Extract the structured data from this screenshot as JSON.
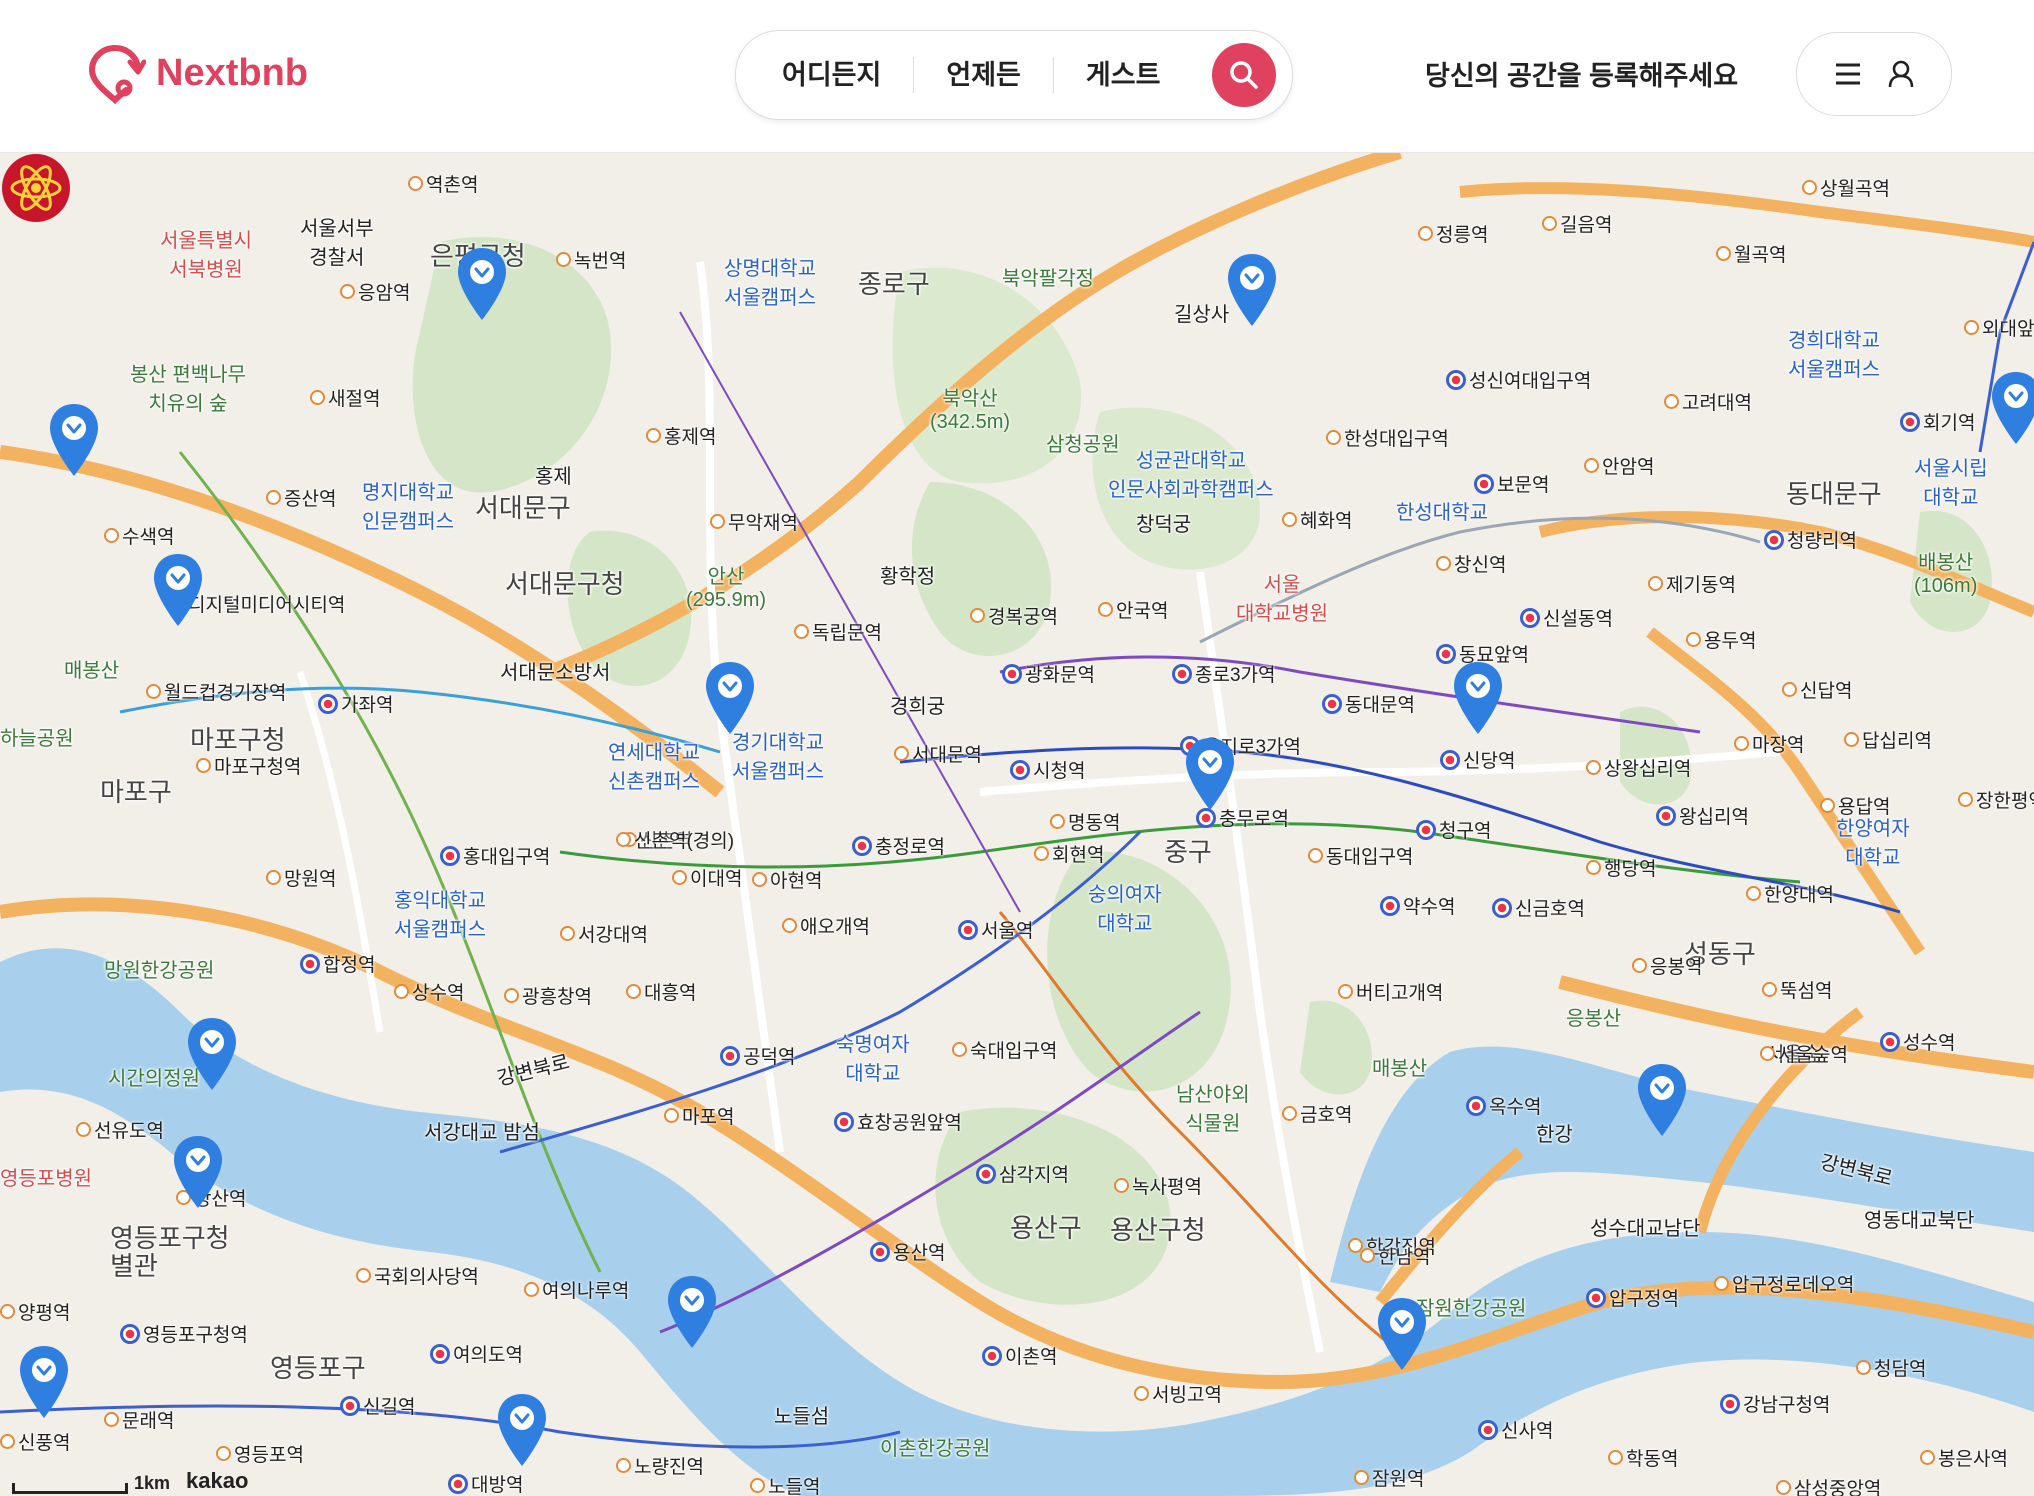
{
  "header": {
    "brand": "Nextbnb",
    "search": {
      "where": "어디든지",
      "when": "언제든",
      "guests": "게스트"
    },
    "host_link": "당신의 공간을 등록해주세요"
  },
  "colors": {
    "brand": "#e0415f",
    "water": "#a8d0ec",
    "park": "#cfe3c3",
    "road_major": "#f3b260"
  },
  "map": {
    "attribution": "kakao",
    "scale_label": "1km",
    "districts": [
      "종로구",
      "서대문구",
      "마포구",
      "동대문구",
      "중구",
      "용산구",
      "영등포구",
      "성동구"
    ],
    "labels": {
      "jongno_gu": "종로구",
      "seodaemun_gu": "서대문구",
      "seodaemun_office": "서대문구청",
      "mapo_gu": "마포구",
      "mapo_office": "마포구청",
      "dongdaemun_gu": "동대문구",
      "jung_gu": "중구",
      "yongsan_gu": "용산구",
      "yongsan_office": "용산구청",
      "yeongdeungpo_gu": "영등포구",
      "yeongdeungpo_office": "영등포구청\n별관",
      "seongdong_gu": "성동구",
      "eunpyeong_office": "은평구청",
      "gilsangsa": "길상사",
      "bugaksan": "북악산\n(342.5m)",
      "bugak_palgakjeong": "북악팔각정",
      "samcheong_park": "삼청공원",
      "ansan": "안산\n(295.9m)",
      "inwang": "홍제",
      "sangmyung": "상명대학교\n서울캠퍼스",
      "skku": "성균관대학교\n인문사회과학캠퍼스",
      "hansung": "한성대학교",
      "myongji": "명지대학교\n인문캠퍼스",
      "yonsei": "연세대학교\n신촌캠퍼스",
      "kyonggi": "경기대학교\n서울캠퍼스",
      "hongik": "홍익대학교\n서울캠퍼스",
      "sookmyung": "숙명여자\n대학교",
      "sungshin": "숭의여자\n대학교",
      "kyunghee": "경희대학교\n서울캠퍼스",
      "uos": "서울시립\n대학교",
      "hanyang": "한양여자\n대학교",
      "seoul_univ_hospital": "서울\n대학교병원",
      "seobuk_hospital": "서울특별시\n서북병원",
      "seoul_seobu_police": "서울서부\n경찰서",
      "seodaemun_fire": "서대문소방서",
      "changdeokgung": "창덕궁",
      "gyeonghuigung": "경희궁",
      "hwanghakjeong": "황학정",
      "bongsan": "봉산 편백나무\n치유의 숲",
      "maebongsan": "매봉산",
      "maebongsan2": "매봉산",
      "baebongsan": "배봉산\n(106m)",
      "eungbongsan": "응봉산",
      "namsan": "남산야외\n식물원",
      "mangwon_park": "망원한강공원",
      "ichon_park": "이촌한강공원",
      "jamwon_park": "잠원한강공원",
      "seoul_forest": "서울숲",
      "nodeulseom": "노들섬",
      "bamseom": "서강대교 밤섬",
      "gangbyeonbukro": "강변북로",
      "hangang": "한강",
      "sigan_garden": "시간의정원",
      "wcup_park": "하늘공원",
      "yeongdong_bridge": "영동대교북단",
      "seongsu_bridge": "성수대교남단",
      "yeongdeungpo_hospital": "영등포병원"
    },
    "stations": [
      "역촌역",
      "녹번역",
      "응암역",
      "새절역",
      "증산역",
      "수색역",
      "디지털미디어시티역",
      "월드컵경기장역",
      "가좌역",
      "마포구청역",
      "망원역",
      "합정역",
      "상수역",
      "광흥창역",
      "대흥역",
      "공덕역",
      "마포역",
      "홍대입구역",
      "신촌역",
      "이대역",
      "아현역",
      "애오개역",
      "충정로역",
      "서대문역",
      "광화문역",
      "시청역",
      "종로3가역",
      "을지로3가역",
      "충무로역",
      "명동역",
      "회현역",
      "서울역",
      "숙대입구역",
      "효창공원앞역",
      "삼각지역",
      "녹사평역",
      "용산역",
      "이촌역",
      "서빙고역",
      "한강진역",
      "버티고개역",
      "약수역",
      "청구역",
      "동대입구역",
      "신당역",
      "동대문역",
      "동묘앞역",
      "신설동역",
      "보문역",
      "성신여대입구역",
      "한성대입구역",
      "혜화역",
      "안국역",
      "경복궁역",
      "독립문역",
      "무악재역",
      "홍제역",
      "정릉역",
      "길음역",
      "월곡역",
      "상월곡역",
      "고려대역",
      "안암역",
      "창신역",
      "제기동역",
      "청량리역",
      "회기역",
      "용두역",
      "신답역",
      "답십리역",
      "마장역",
      "상왕십리역",
      "왕십리역",
      "행당역",
      "신금호역",
      "한양대역",
      "응봉역",
      "뚝섬역",
      "성수역",
      "서울숲역",
      "옥수역",
      "금호역",
      "한남역",
      "압구정역",
      "압구정로데오역",
      "신사역",
      "잠원역",
      "강남구청역",
      "청담역",
      "학동역",
      "삼성중앙역",
      "봉은사역",
      "노량진역",
      "노들역",
      "대방역",
      "신길역",
      "여의도역",
      "여의나루역",
      "국회의사당역",
      "영등포구청역",
      "영등포역",
      "당산역",
      "선유도역",
      "양평역",
      "문래역",
      "신풍역",
      "장한평역",
      "용답역",
      "외대앞역",
      "서강대역",
      "신촌역(경의)"
    ],
    "listing_pins": 18
  }
}
